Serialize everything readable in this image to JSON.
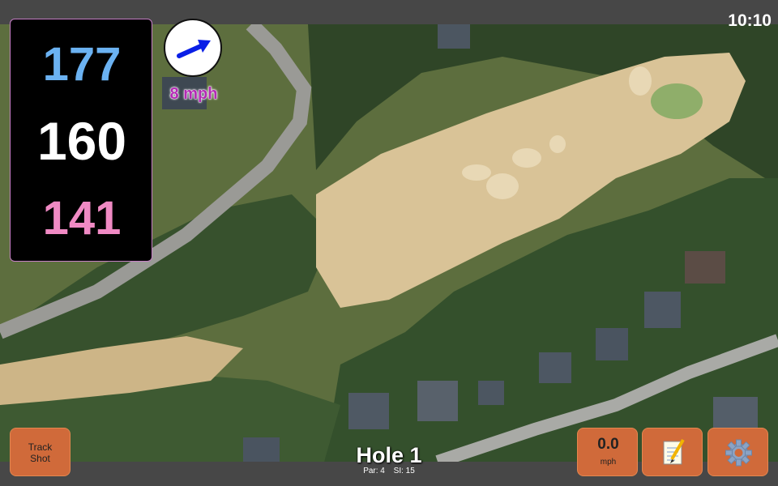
{
  "clock": "10:10",
  "distances": {
    "back": "177",
    "center": "160",
    "front": "141"
  },
  "wind": {
    "speed": "8 mph",
    "icon": "wind-direction-arrow-icon"
  },
  "buttons": {
    "track_shot": [
      "Track",
      "Shot"
    ],
    "speed_value": "0.0",
    "speed_unit": "mph",
    "notes_icon": "notepad-icon",
    "settings_icon": "gear-icon"
  },
  "hole": {
    "title": "Hole 1",
    "par": "Par: 4",
    "si": "SI: 15"
  },
  "colors": {
    "back": "#6bb2f2",
    "center": "#ffffff",
    "front": "#f08ac4",
    "button": "#d06a3a",
    "wind": "#b42ab4"
  }
}
